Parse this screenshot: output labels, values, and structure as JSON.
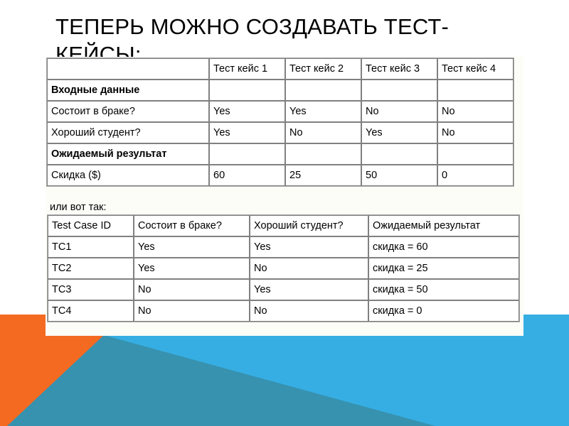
{
  "slide": {
    "title": "Теперь можно создавать тест-кейсы:",
    "caption": "или вот так:",
    "colors": {
      "orange": "#F46A21",
      "teal_dark": "#3792B0",
      "blue_light": "#36AEE3",
      "panel_background": "#FDFDF8",
      "table_border": "#808080",
      "table_outer_border": "#A6A6A6",
      "text": "#000000"
    }
  },
  "table1": {
    "name": "test-case-matrix",
    "headers": [
      "",
      "Тест кейс 1",
      "Тест кейс 2",
      "Тест кейс 3",
      "Тест кейс 4"
    ],
    "rows": [
      {
        "label": "Входные данные",
        "bold": true,
        "cells": [
          "",
          "",
          "",
          ""
        ]
      },
      {
        "label": "Состоит в браке?",
        "bold": false,
        "cells": [
          "Yes",
          "Yes",
          "No",
          "No"
        ]
      },
      {
        "label": "Хороший студент?",
        "bold": false,
        "cells": [
          "Yes",
          "No",
          "Yes",
          "No"
        ]
      },
      {
        "label": "Ожидаемый результат",
        "bold": true,
        "cells": [
          "",
          "",
          "",
          ""
        ]
      },
      {
        "label": "Скидка ($)",
        "bold": false,
        "cells": [
          "60",
          "25",
          "50",
          "0"
        ]
      }
    ]
  },
  "table2": {
    "name": "test-case-list",
    "headers": [
      "Test Case ID",
      "Состоит в браке?",
      "Хороший студент?",
      "Ожидаемый результат"
    ],
    "rows": [
      [
        "TC1",
        "Yes",
        "Yes",
        "скидка = 60"
      ],
      [
        "TC2",
        "Yes",
        "No",
        "скидка = 25"
      ],
      [
        "TC3",
        "No",
        "Yes",
        "скидка = 50"
      ],
      [
        "TC4",
        "No",
        "No",
        "скидка = 0"
      ]
    ]
  }
}
